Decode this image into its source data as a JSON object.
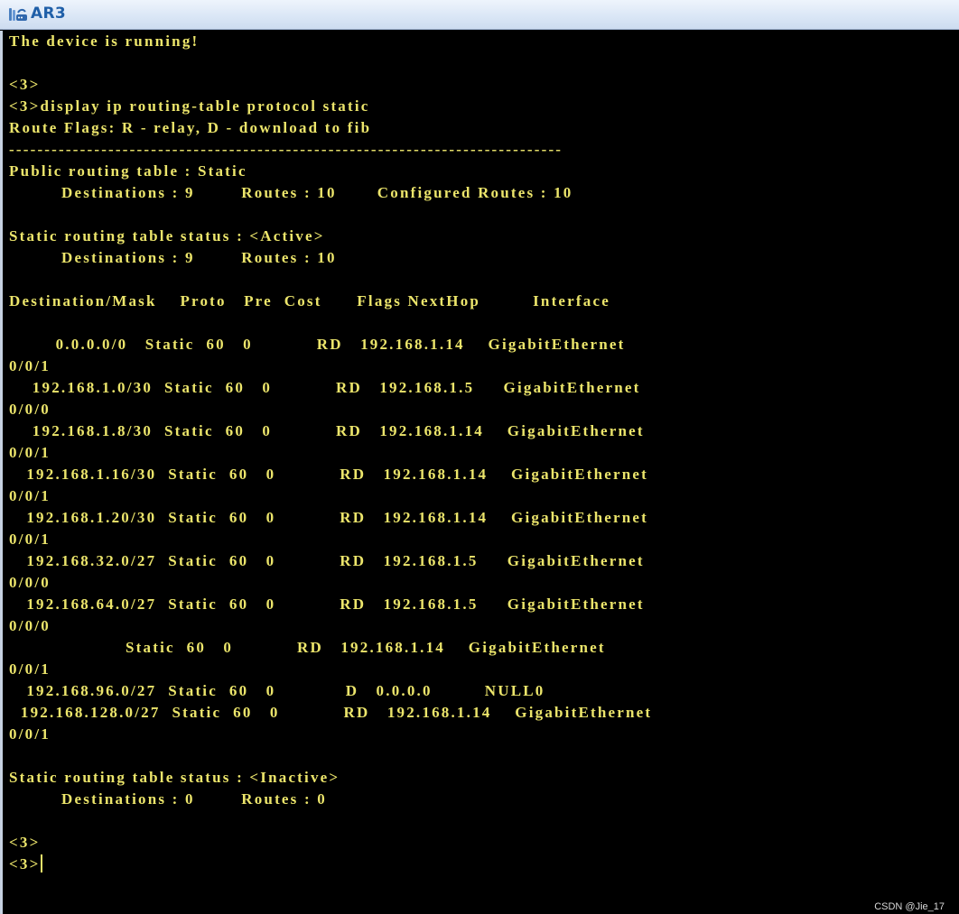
{
  "window": {
    "title": "AR3",
    "icon": "router-app-icon"
  },
  "terminal": {
    "lines": [
      "The device is running!",
      "",
      "<3>",
      "<3>display ip routing-table protocol static",
      "Route Flags: R - relay, D - download to fib",
      "------------------------------------------------------------------------------",
      "Public routing table : Static",
      "         Destinations : 9        Routes : 10       Configured Routes : 10",
      "",
      "Static routing table status : <Active>",
      "         Destinations : 9        Routes : 10",
      "",
      "Destination/Mask    Proto   Pre  Cost      Flags NextHop         Interface",
      "",
      "        0.0.0.0/0   Static  60   0           RD   192.168.1.14    GigabitEthernet",
      "0/0/1",
      "    192.168.1.0/30  Static  60   0           RD   192.168.1.5     GigabitEthernet",
      "0/0/0",
      "    192.168.1.8/30  Static  60   0           RD   192.168.1.14    GigabitEthernet",
      "0/0/1",
      "   192.168.1.16/30  Static  60   0           RD   192.168.1.14    GigabitEthernet",
      "0/0/1",
      "   192.168.1.20/30  Static  60   0           RD   192.168.1.14    GigabitEthernet",
      "0/0/1",
      "   192.168.32.0/27  Static  60   0           RD   192.168.1.5     GigabitEthernet",
      "0/0/0",
      "   192.168.64.0/27  Static  60   0           RD   192.168.1.5     GigabitEthernet",
      "0/0/0",
      "                    Static  60   0           RD   192.168.1.14    GigabitEthernet",
      "0/0/1",
      "   192.168.96.0/27  Static  60   0            D   0.0.0.0         NULL0",
      "  192.168.128.0/27  Static  60   0           RD   192.168.1.14    GigabitEthernet",
      "0/0/1",
      "",
      "Static routing table status : <Inactive>",
      "         Destinations : 0        Routes : 0",
      "",
      "<3>",
      "<3>"
    ]
  },
  "watermark": "CSDN @Jie_17",
  "colors": {
    "terminal_text": "#ece56b",
    "terminal_background": "#000000",
    "title_text": "#1f5fa8"
  }
}
